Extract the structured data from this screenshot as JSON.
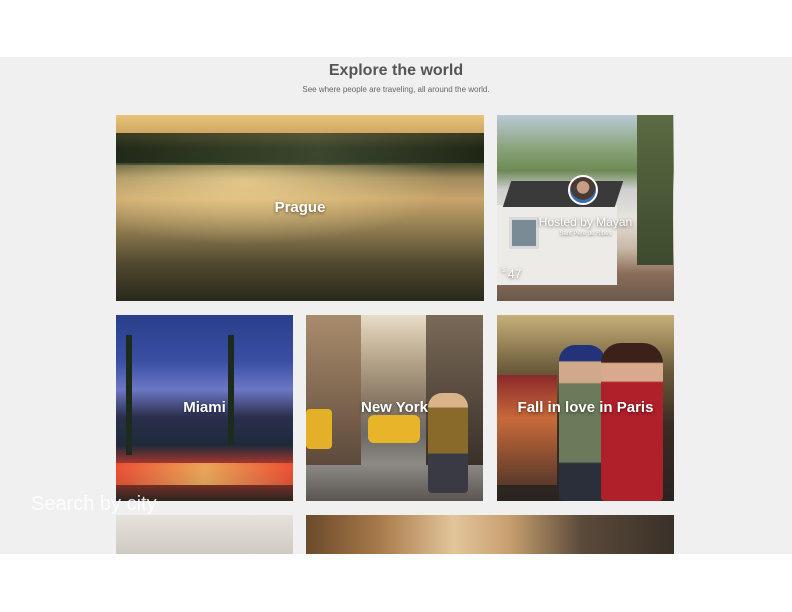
{
  "header": {
    "title": "Explore the world",
    "subtitle": "See where people are traveling, all around the world."
  },
  "cards": {
    "prague": {
      "label": "Prague"
    },
    "host": {
      "name": "Hosted by Mayan",
      "location": "Sant Pere de Ribes",
      "currency": "$",
      "price": "47"
    },
    "miami": {
      "label": "Miami"
    },
    "newyork": {
      "label": "New York"
    },
    "paris": {
      "label": "Fall in love in Paris"
    }
  },
  "search": {
    "placeholder": "Search by city"
  },
  "colors": {
    "page_background": "#f0f0f0",
    "title_text": "#555555",
    "card_label": "#ffffff"
  }
}
